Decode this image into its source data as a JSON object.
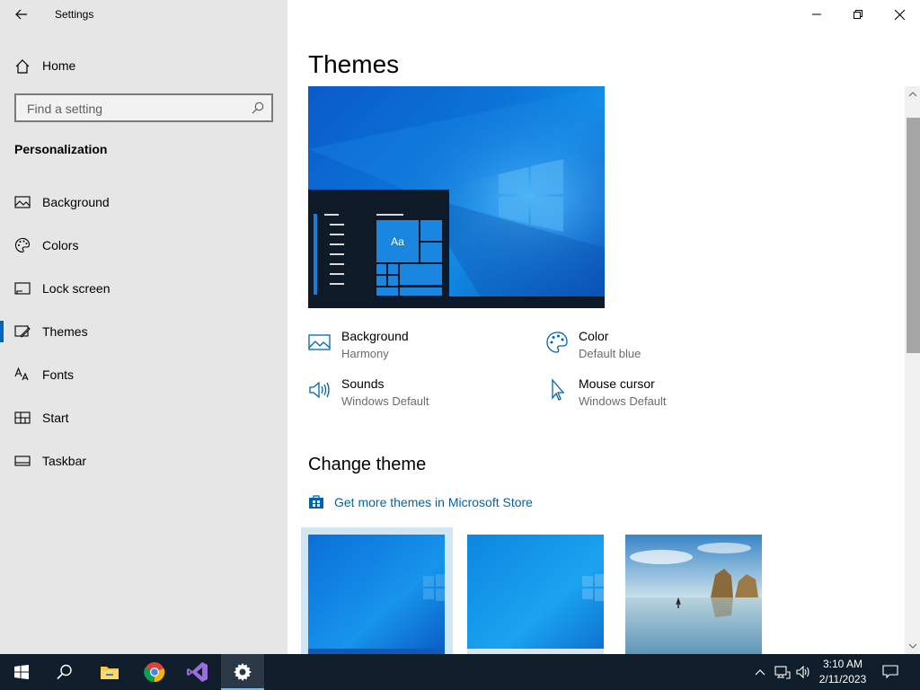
{
  "window": {
    "title": "Settings"
  },
  "sidebar": {
    "home_label": "Home",
    "search_placeholder": "Find a setting",
    "section_title": "Personalization",
    "items": [
      {
        "label": "Background",
        "icon": "picture-icon"
      },
      {
        "label": "Colors",
        "icon": "palette-icon"
      },
      {
        "label": "Lock screen",
        "icon": "lock-screen-icon"
      },
      {
        "label": "Themes",
        "icon": "themes-icon",
        "selected": true
      },
      {
        "label": "Fonts",
        "icon": "fonts-icon"
      },
      {
        "label": "Start",
        "icon": "start-icon"
      },
      {
        "label": "Taskbar",
        "icon": "taskbar-icon"
      }
    ]
  },
  "main": {
    "title": "Themes",
    "preview_tile_text": "Aa",
    "props": [
      {
        "name": "Background",
        "value": "Harmony",
        "icon": "picture-icon"
      },
      {
        "name": "Color",
        "value": "Default blue",
        "icon": "palette-icon"
      },
      {
        "name": "Sounds",
        "value": "Windows Default",
        "icon": "speaker-icon"
      },
      {
        "name": "Mouse cursor",
        "value": "Windows Default",
        "icon": "cursor-icon"
      }
    ],
    "change_theme_title": "Change theme",
    "store_link": "Get more themes in Microsoft Store"
  },
  "taskbar": {
    "time": "3:10 AM",
    "date": "2/11/2023",
    "apps": [
      "start-icon",
      "search-icon",
      "file-explorer-icon",
      "chrome-icon",
      "visual-studio-icon",
      "settings-icon"
    ]
  },
  "colors": {
    "accent": "#0067c0",
    "link": "#0063b1",
    "sidebar_bg": "#e6e6e6",
    "taskbar_bg": "#101d2a"
  }
}
